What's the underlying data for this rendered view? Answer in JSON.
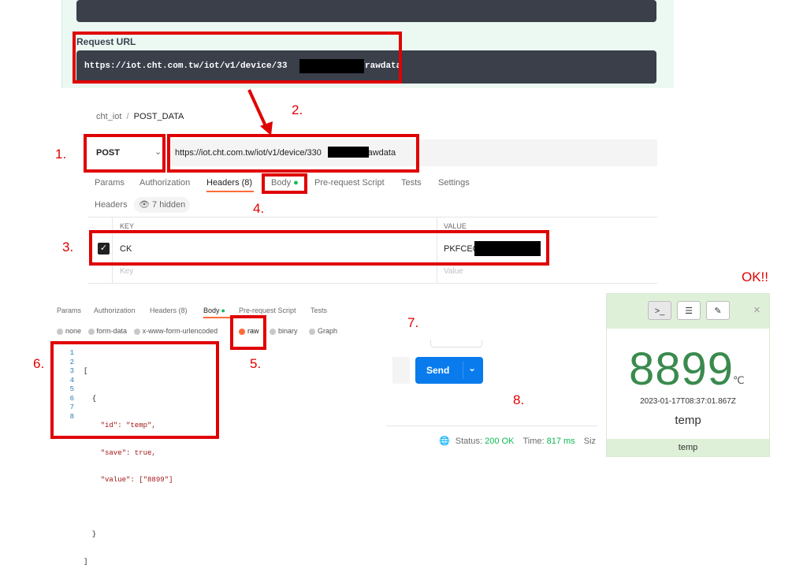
{
  "swagger": {
    "title": "Request URL",
    "url_prefix": "https://iot.cht.com.tw/iot/v1/device/33",
    "url_suffix": "/rawdata"
  },
  "request": {
    "breadcrumb_parent": "cht_iot",
    "breadcrumb_sep": "/",
    "breadcrumb_current": "POST_DATA",
    "method": "POST",
    "url_prefix": "https://iot.cht.com.tw/iot/v1/device/330",
    "url_suffix": "/rawdata",
    "tabs": [
      "Params",
      "Authorization",
      "Headers (8)",
      "Body",
      "Pre-request Script",
      "Tests",
      "Settings"
    ],
    "headers_label": "Headers",
    "hidden_label": "7 hidden",
    "col_key": "KEY",
    "col_value": "VALUE",
    "row_key": "CK",
    "row_value": "PKFCEC",
    "placeholder_key": "Key",
    "placeholder_value": "Value"
  },
  "body_panel": {
    "tabs": [
      "Params",
      "Authorization",
      "Headers (8)",
      "Body",
      "Pre-request Script",
      "Tests"
    ],
    "modes": [
      "none",
      "form-data",
      "x-www-form-urlencoded",
      "raw",
      "binary",
      "Graph"
    ],
    "line_numbers": [
      "1",
      "2",
      "3",
      "4",
      "5",
      "6",
      "7",
      "8"
    ],
    "code_lines": [
      "[",
      "  {",
      "    \"id\": \"temp\",",
      "    \"save\": true,",
      "    \"value\": [\"8899\"]",
      "    ",
      "  }",
      "]"
    ]
  },
  "send_label": "Send",
  "status": {
    "status_label": "Status:",
    "status_value": "200 OK",
    "time_label": "Time:",
    "time_value": "817 ms",
    "size_label": "Siz"
  },
  "widget": {
    "value": "8899",
    "unit": "℃",
    "timestamp": "2023-01-17T08:37:01.867Z",
    "sensor": "temp",
    "footer": "temp",
    "close": "×"
  },
  "annotations": {
    "ok": "OK!!",
    "s1": "1.",
    "s2": "2.",
    "s3": "3.",
    "s4": "4.",
    "s5": "5.",
    "s6": "6.",
    "s7": "7.",
    "s8": "8."
  },
  "colors": {
    "annotation_red": "#e00000",
    "status_green": "#0cbb52",
    "widget_green": "#3a8a4e",
    "send_blue": "#097bed"
  }
}
